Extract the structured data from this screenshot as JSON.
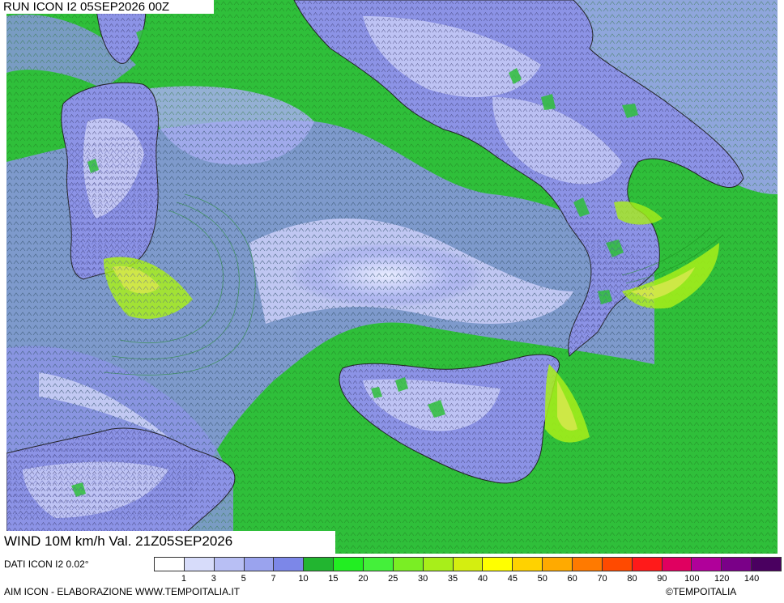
{
  "header": {
    "run_label": "RUN ICON I2 05SEP2026 00Z"
  },
  "map": {
    "title": "WIND 10M km/h Val. 21Z05SEP2026",
    "colors": {
      "sea_green": "#2fbf3a",
      "land_lavender": "#8c93e6",
      "calm_white": "#e8ecff",
      "coast": "#222222",
      "gust_yellow": "#d4e84a"
    }
  },
  "legend": {
    "source_text": "DATI ICON I2 0.02°",
    "ticks": [
      "1",
      "3",
      "5",
      "7",
      "10",
      "15",
      "20",
      "25",
      "30",
      "35",
      "40",
      "45",
      "50",
      "60",
      "70",
      "80",
      "90",
      "100",
      "120",
      "140"
    ],
    "colors": [
      "#ffffff",
      "#d7dcfa",
      "#b8bff4",
      "#9aa3ee",
      "#7c87e8",
      "#22b530",
      "#22ee22",
      "#44f03a",
      "#7aee24",
      "#a8ee1a",
      "#d4ee10",
      "#ffff00",
      "#ffd200",
      "#ffaa00",
      "#ff7a00",
      "#ff4a00",
      "#ff1a1a",
      "#e00060",
      "#b0009a",
      "#7a0088",
      "#4a0060"
    ]
  },
  "footer": {
    "credits": "AIM ICON - ELABORAZIONE WWW.TEMPOITALIA.IT",
    "copyright": "©TEMPOITALIA"
  }
}
